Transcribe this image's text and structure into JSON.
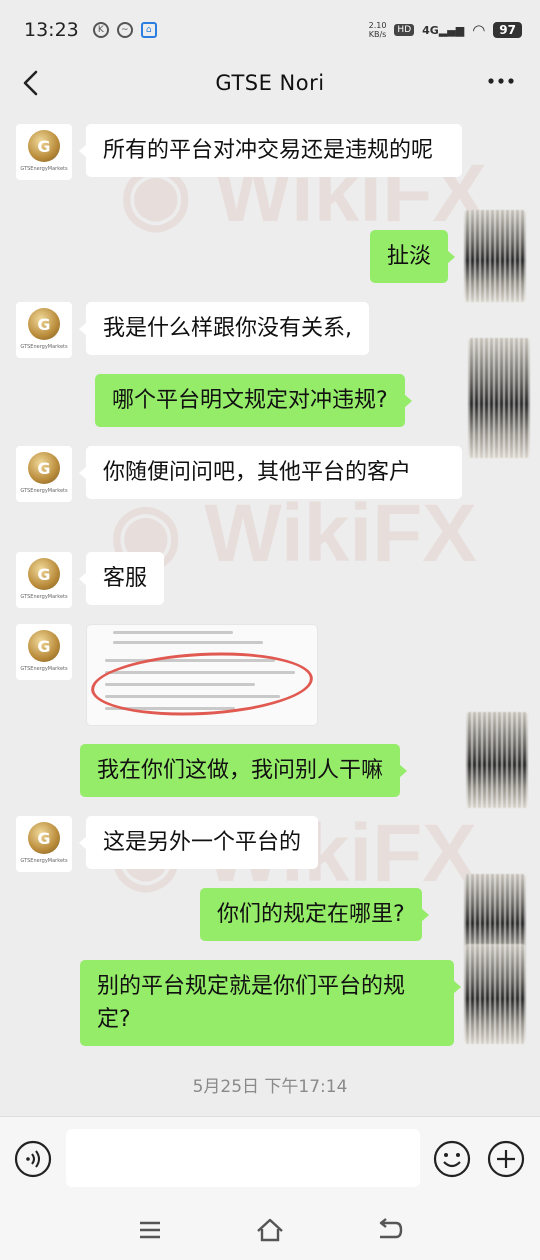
{
  "status_bar": {
    "time": "13:23",
    "net_speed_value": "2.10",
    "net_speed_unit": "KB/s",
    "hd": "HD",
    "signal": "4G",
    "battery": "97"
  },
  "header": {
    "title": "GTSE  Nori"
  },
  "avatar": {
    "brand_text": "GTSEnergyMarkets"
  },
  "messages": [
    {
      "side": "left",
      "text": "所有的平台对冲交易还是违规的呢"
    },
    {
      "side": "right",
      "text": "扯淡"
    },
    {
      "side": "left",
      "text": "我是什么样跟你没有关系,"
    },
    {
      "side": "right",
      "text": "哪个平台明文规定对冲违规?"
    },
    {
      "side": "left",
      "text": "你随便问问吧，其他平台的客户"
    },
    {
      "side": "left",
      "text": "客服"
    },
    {
      "side": "left",
      "type": "image"
    },
    {
      "side": "right",
      "text": "我在你们这做，我问别人干嘛"
    },
    {
      "side": "left",
      "text": "这是另外一个平台的"
    },
    {
      "side": "right",
      "text": "你们的规定在哪里?"
    },
    {
      "side": "right",
      "text": "别的平台规定就是你们平台的规定?"
    }
  ],
  "timestamp": "5月25日 下午17:14",
  "watermark": "WikiFX",
  "input": {
    "placeholder": ""
  },
  "colors": {
    "background": "#ededed",
    "bubble_self": "#95ec69",
    "bubble_other": "#ffffff"
  }
}
